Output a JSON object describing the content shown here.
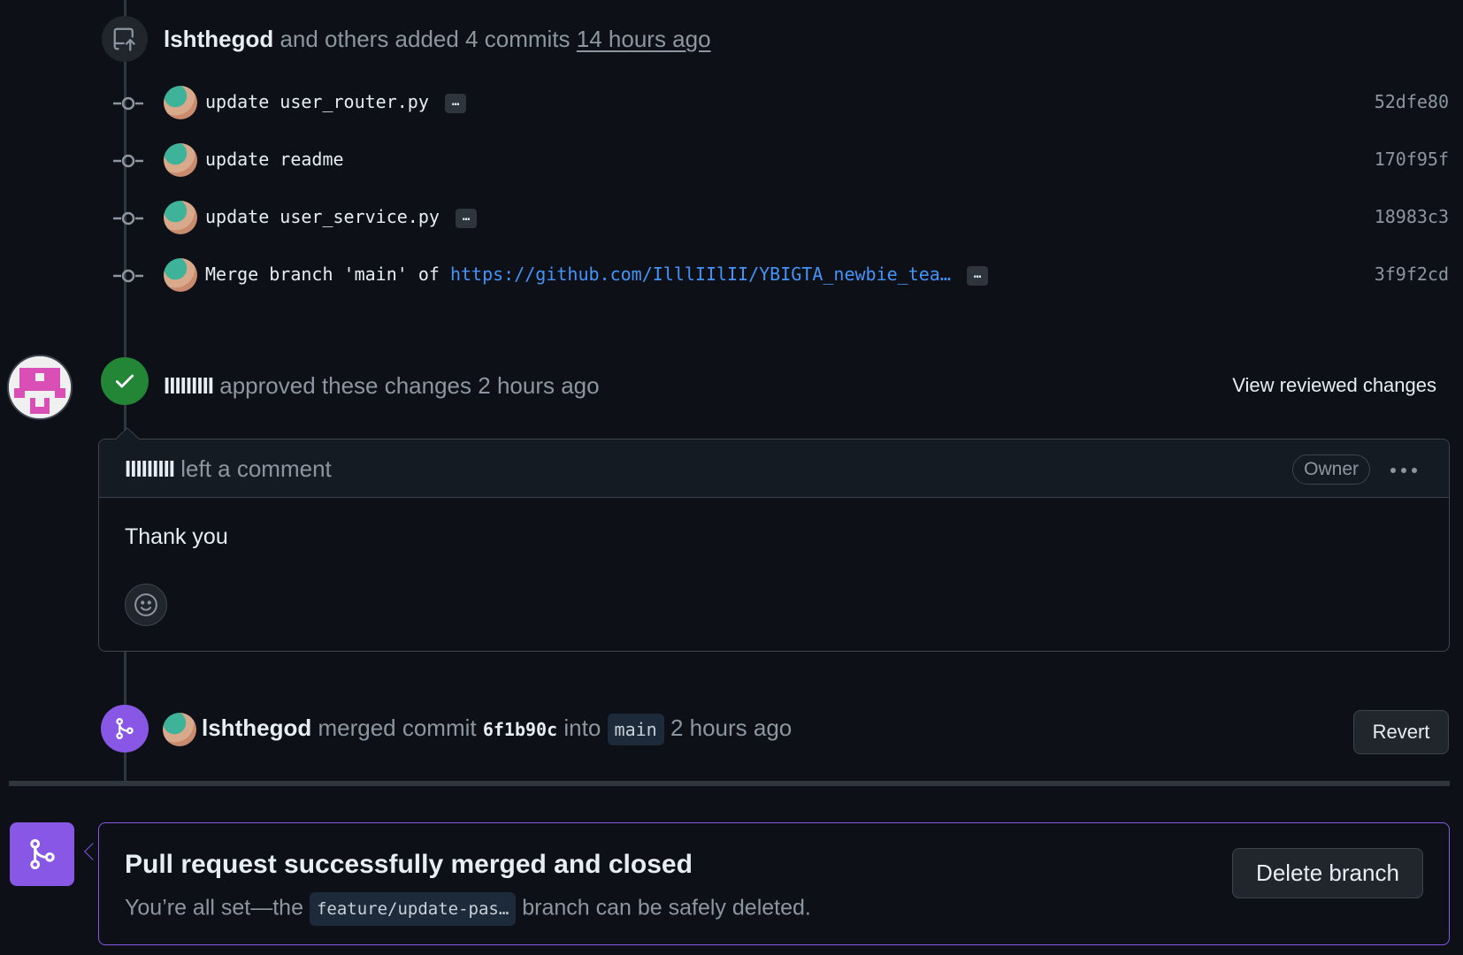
{
  "push_event": {
    "user": "lshthegod",
    "action": "and others added 4 commits",
    "time": "14 hours ago",
    "icon": "repo-push-icon"
  },
  "commits": [
    {
      "message": "update user_router.py",
      "link": "",
      "has_more": true,
      "sha": "52dfe80"
    },
    {
      "message": "update readme",
      "link": "",
      "has_more": false,
      "sha": "170f95f"
    },
    {
      "message": "update user_service.py",
      "link": "",
      "has_more": true,
      "sha": "18983c3"
    },
    {
      "message": "Merge branch 'main' of ",
      "link": "https://github.com/IlllIIlII/YBIGTA_newbie_tea…",
      "has_more": true,
      "sha": "3f9f2cd"
    }
  ],
  "more_label": "…",
  "review": {
    "user": "IIIIIIIII",
    "action": "approved these changes",
    "time": "2 hours ago",
    "view_button": "View reviewed changes",
    "icon": "check-icon"
  },
  "comment": {
    "user": "IIIIIIIII",
    "action": "left a comment",
    "role_badge": "Owner",
    "body": "Thank you",
    "menu_icon": "kebab-horizontal-icon",
    "reaction_icon": "smiley-icon"
  },
  "merge_event": {
    "user": "lshthegod",
    "action": "merged commit",
    "sha": "6f1b90c",
    "into": "into",
    "branch": "main",
    "time": "2 hours ago",
    "revert_button": "Revert",
    "icon": "git-merge-icon"
  },
  "merged_banner": {
    "title": "Pull request successfully merged and closed",
    "sub_before": "You’re all set—the",
    "branch": "feature/update-pas…",
    "sub_after": "branch can be safely deleted.",
    "delete_button": "Delete branch",
    "icon": "git-merge-icon"
  },
  "colors": {
    "background": "#0d1117",
    "approve_green": "#238636",
    "merge_purple": "#8957e5",
    "link_blue": "#4493f8",
    "muted_text": "#8d96a0"
  }
}
